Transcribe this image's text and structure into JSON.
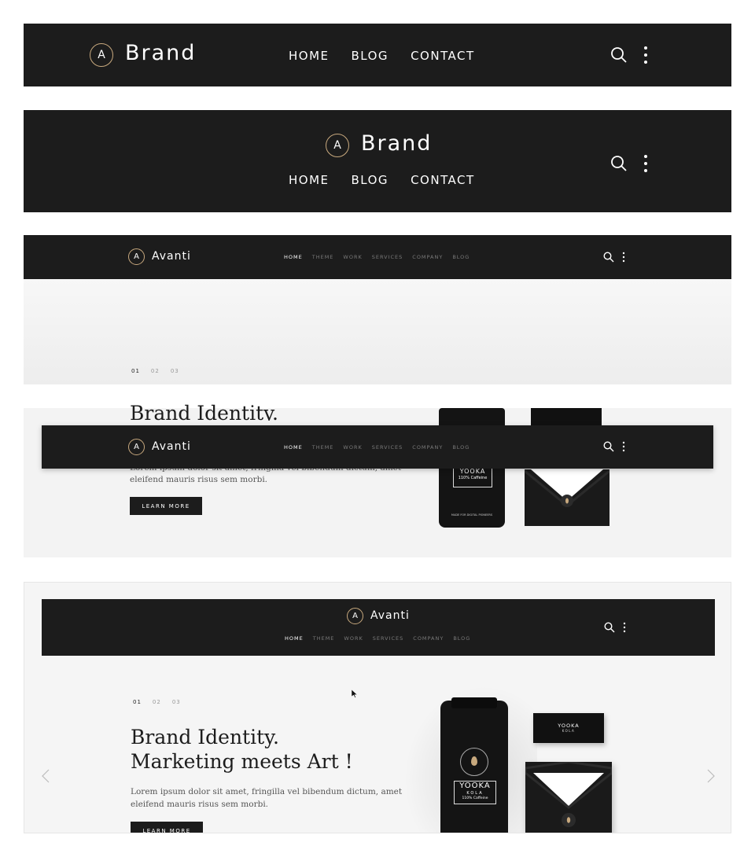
{
  "variant1": {
    "logo_letter": "A",
    "brand": "Brand",
    "nav": [
      "HOME",
      "BLOG",
      "CONTACT"
    ]
  },
  "variant2": {
    "logo_letter": "A",
    "brand": "Brand",
    "nav": [
      "HOME",
      "BLOG",
      "CONTACT"
    ]
  },
  "variant3": {
    "logo_letter": "A",
    "brand": "Avanti",
    "nav": [
      "HOME",
      "THEME",
      "WORK",
      "SERVICES",
      "COMPANY",
      "BLOG"
    ],
    "active_nav": "HOME",
    "slides": [
      "01",
      "02",
      "03"
    ],
    "sticky": {
      "logo_letter": "A",
      "brand": "Avanti",
      "nav": [
        "HOME",
        "THEME",
        "WORK",
        "SERVICES",
        "COMPANY",
        "BLOG"
      ]
    },
    "hero": {
      "heading_fragment": "Brand Identity.",
      "body_fragment": "Lorem ipsum dolor sit amet, fringilla vel bibendum dictum, amet",
      "body_line2": "eleifend mauris risus sem morbi.",
      "button": "LEARN MORE"
    }
  },
  "variant4": {
    "logo_letter": "A",
    "brand": "Avanti",
    "nav": [
      "HOME",
      "THEME",
      "WORK",
      "SERVICES",
      "COMPANY",
      "BLOG"
    ],
    "active_nav": "HOME",
    "slides": [
      "01",
      "02",
      "03"
    ],
    "hero": {
      "heading_line1": "Brand Identity.",
      "heading_line2": "Marketing meets Art !",
      "body_line1": "Lorem ipsum dolor sit amet, fringilla vel bibendum dictum, amet",
      "body_line2": "eleifend mauris risus sem morbi.",
      "button": "LEARN MORE"
    }
  },
  "product": {
    "bottle_brand": "YOOKA",
    "bottle_sub": "KOLA",
    "bottle_tag": "110% Caffeine",
    "bottle_footer": "MADE FOR DIGITAL PIONEERS",
    "card_brand": "YOOKA",
    "card_sub": "KOLA"
  },
  "colors": {
    "bar": "#1c1c1c",
    "accent": "#c8a97e",
    "hero_bg": "#f4f4f4"
  }
}
